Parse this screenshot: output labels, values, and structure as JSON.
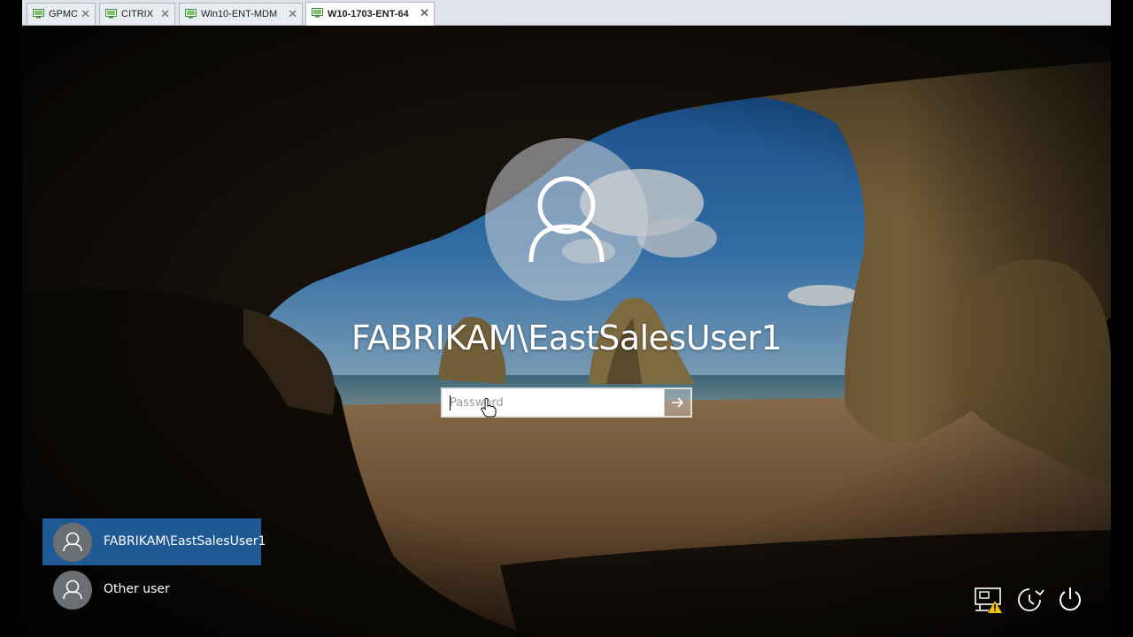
{
  "tabs": [
    {
      "label": "GPMC",
      "close": "✕",
      "active": false
    },
    {
      "label": "CITRIX",
      "close": "✕",
      "active": false
    },
    {
      "label": "Win10-ENT-MDM",
      "close": "✕",
      "active": false
    },
    {
      "label": "W10-1703-ENT-64",
      "close": "✕",
      "active": true
    }
  ],
  "login": {
    "username": "FABRIKAM\\EastSalesUser1",
    "password_placeholder": "Password",
    "submit_glyph": "→"
  },
  "users": [
    {
      "name": "FABRIKAM\\EastSalesUser1",
      "selected": true
    },
    {
      "name": "Other user",
      "selected": false
    }
  ],
  "system_icons": [
    "network-warning-icon",
    "ease-of-access-icon",
    "power-icon"
  ],
  "colors": {
    "selected_user_bg": "#1f5a96",
    "warning": "#f2c200",
    "tabbar_bg": "#dfe3ea"
  }
}
